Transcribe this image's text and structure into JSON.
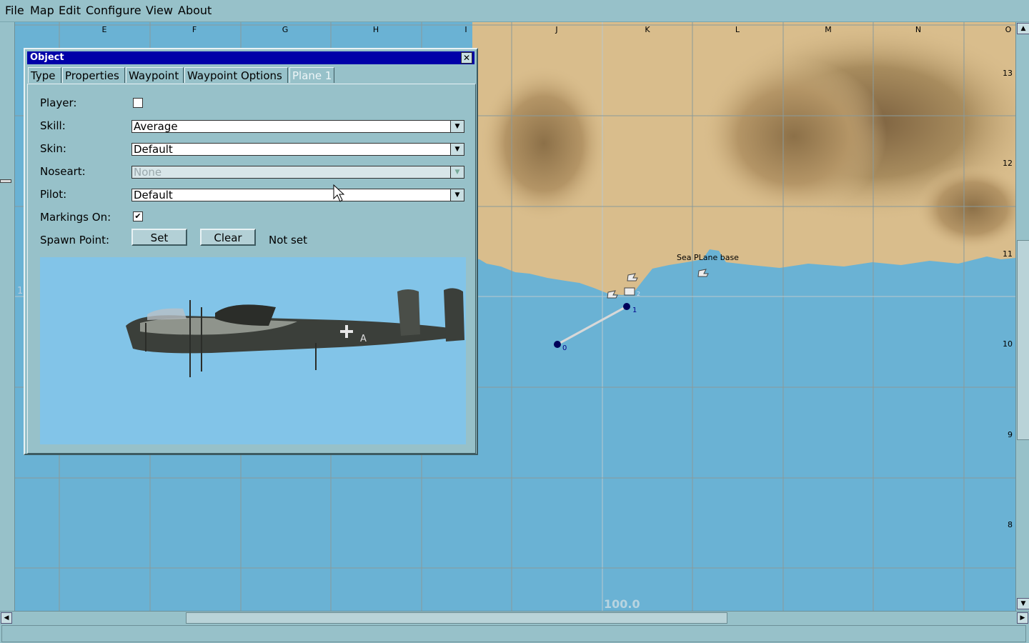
{
  "menu": [
    "File",
    "Map",
    "Edit",
    "Configure",
    "View",
    "About"
  ],
  "map": {
    "columns": [
      "E",
      "F",
      "G",
      "H",
      "I",
      "J",
      "K",
      "L",
      "M",
      "N",
      "O"
    ],
    "rows": [
      "13",
      "12",
      "11",
      "10",
      "9",
      "8"
    ],
    "partial_row_label": "1",
    "base_label": "Sea PLane base",
    "waypoints": [
      "0",
      "1"
    ],
    "icon_labels": [
      "2"
    ],
    "scale_label": "100.0",
    "colors": {
      "sea": "#6ab2d4",
      "land": "#d9bd8c",
      "mountain": "#a0845a",
      "grid": "#8a9a9a",
      "waypoint": "#00005a",
      "route": "#d8d8d8"
    }
  },
  "dialog": {
    "title": "Object",
    "close_icon": "close-icon",
    "tabs": [
      "Type",
      "Properties",
      "Waypoint",
      "Waypoint Options",
      "Plane 1"
    ],
    "active_tab": "Plane 1",
    "fields": {
      "player_label": "Player:",
      "player_checked": false,
      "skill_label": "Skill:",
      "skill_value": "Average",
      "skin_label": "Skin:",
      "skin_value": "Default",
      "noseart_label": "Noseart:",
      "noseart_value": "None",
      "pilot_label": "Pilot:",
      "pilot_value": "Default",
      "markings_label": "Markings On:",
      "markings_checked": true,
      "spawn_label": "Spawn Point:",
      "set_button": "Set",
      "clear_button": "Clear",
      "spawn_status": "Not set"
    },
    "preview": {
      "aircraft_marking": "A",
      "colors": {
        "sky": "#82c4e8",
        "fuselage": "#3b3f3a",
        "camouflage": "#8f948c"
      }
    }
  }
}
